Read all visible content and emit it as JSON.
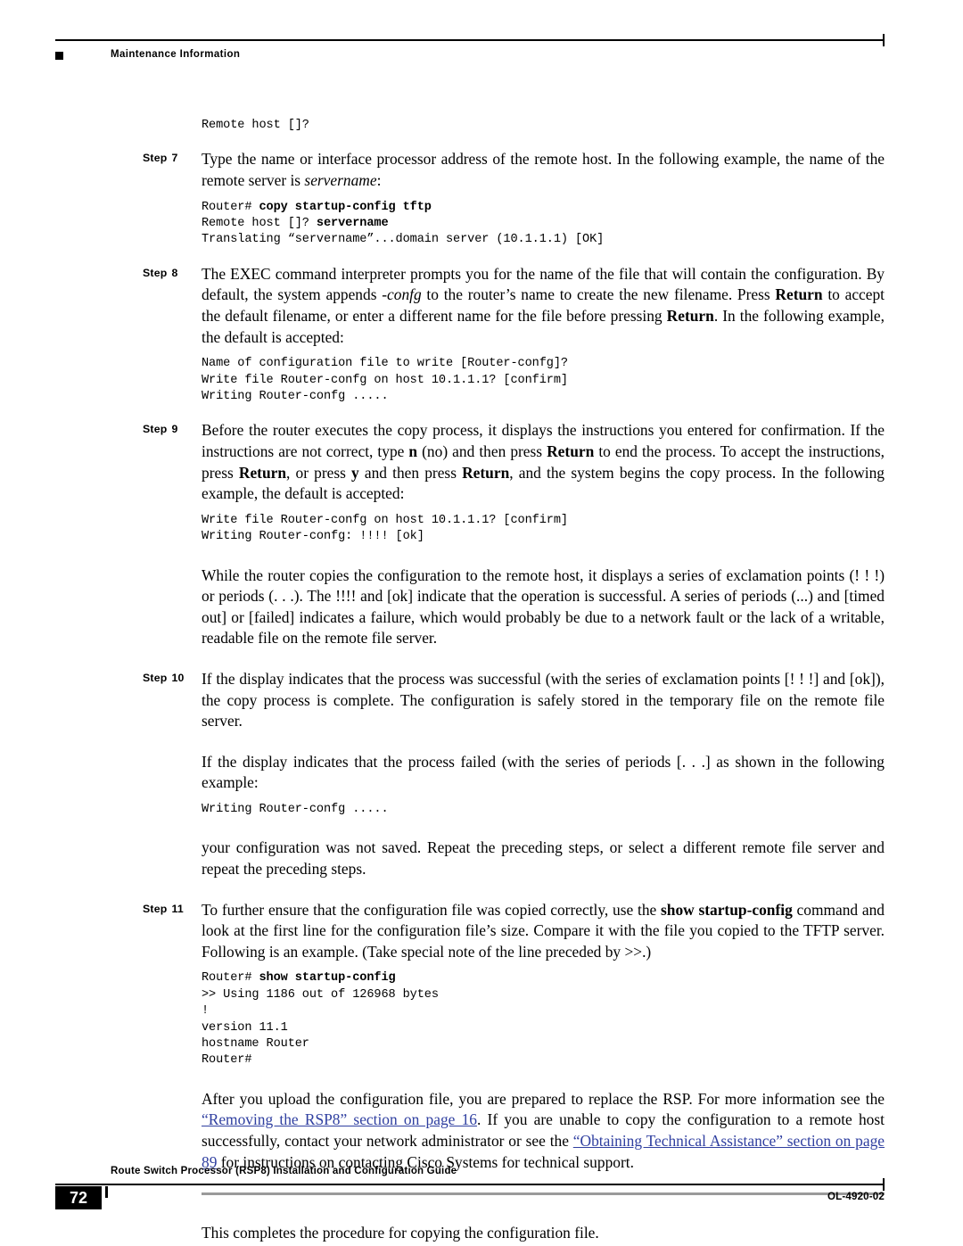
{
  "header": {
    "running_head": "Maintenance Information"
  },
  "body": {
    "pre_step7_code": "Remote host []?",
    "step7": {
      "label": "Step",
      "number": "7",
      "text_1": "Type the name or interface processor address of the remote host. In the following example, the name of the remote server is ",
      "text_italic": "servername",
      "text_2": ":",
      "code_line1_prompt": "Router# ",
      "code_line1_cmd": "copy startup-config tftp",
      "code_line2_prefix": "Remote host []? ",
      "code_line2_bold": "servername",
      "code_line3": "Translating “servername”...domain server (10.1.1.1) [OK]"
    },
    "step8": {
      "label": "Step",
      "number": "8",
      "text_1": "The EXEC command interpreter prompts you for the name of the file that will contain the configuration. By default, the system appends ",
      "text_italic_1": "-confg",
      "text_2": " to the router’s name to create the new filename. Press ",
      "text_bold_1": "Return",
      "text_3": " to accept the default filename, or enter a different name for the file before pressing ",
      "text_bold_2": "Return",
      "text_4": ". In the following example, the default is accepted:",
      "code": "Name of configuration file to write [Router-confg]?\nWrite file Router-confg on host 10.1.1.1? [confirm]\nWriting Router-confg ....."
    },
    "step9": {
      "label": "Step",
      "number": "9",
      "text_1": "Before the router executes the copy process, it displays the instructions you entered for confirmation. If the instructions are not correct, type ",
      "text_bold_1": "n",
      "text_2": " (no) and then press ",
      "text_bold_2": "Return",
      "text_3": " to end the process. To accept the instructions, press ",
      "text_bold_3": "Return",
      "text_4": ", or press ",
      "text_bold_4": "y",
      "text_5": " and then press ",
      "text_bold_5": "Return",
      "text_6": ", and the system begins the copy process. In the following example, the default is accepted:",
      "code": "Write file Router-confg on host 10.1.1.1? [confirm]\nWriting Router-confg: !!!! [ok]"
    },
    "para_after_step9": "While the router copies the configuration to the remote host, it displays a series of exclamation points (! ! !) or periods (. . .). The !!!! and [ok] indicate that the operation is successful. A series of periods (...) and [timed out] or [failed] indicates a failure, which would probably be due to a network fault or the lack of a writable, readable file on the remote file server.",
    "step10": {
      "label": "Step",
      "number": "10",
      "text": "If the display indicates that the process was successful (with the series of exclamation points [! ! !] and [ok]), the copy process is complete. The configuration is safely stored in the temporary file on the remote file server.",
      "para_2": "If the display indicates that the process failed (with the series of periods [. . .] as shown in the following example:",
      "code": "Writing Router-confg .....",
      "para_3": "your configuration was not saved. Repeat the preceding steps, or select a different remote file server and repeat the preceding steps."
    },
    "step11": {
      "label": "Step",
      "number": "11",
      "text_1": "To further ensure that the configuration file was copied correctly, use the ",
      "text_bold_1": "show startup-config",
      "text_2": " command and look at the first line for the configuration file’s size. Compare it with the file you copied to the TFTP server. Following is an example. (Take special note of the line preceded by >>.)",
      "code_prompt": "Router# ",
      "code_cmd": "show startup-config",
      "code_rest": ">> Using 1186 out of 126968 bytes\n!\nversion 11.1\nhostname Router\nRouter#"
    },
    "closing_para": {
      "text_1": "After you upload the configuration file, you are prepared to replace the RSP. For more information see the ",
      "link_1": "“Removing the RSP8” section on page 16",
      "text_2": ". If you are unable to copy the configuration to a remote host successfully, contact your network administrator or see the ",
      "link_2": "“Obtaining Technical Assistance” section on page 89",
      "text_3": " for instructions on contacting Cisco Systems for technical support."
    },
    "final_line": "This completes the procedure for copying the configuration file."
  },
  "footer": {
    "page_number": "72",
    "title": "Route Switch Processor (RSP8) Installation and Configuration Guide",
    "doc_id": "OL-4920-02"
  }
}
